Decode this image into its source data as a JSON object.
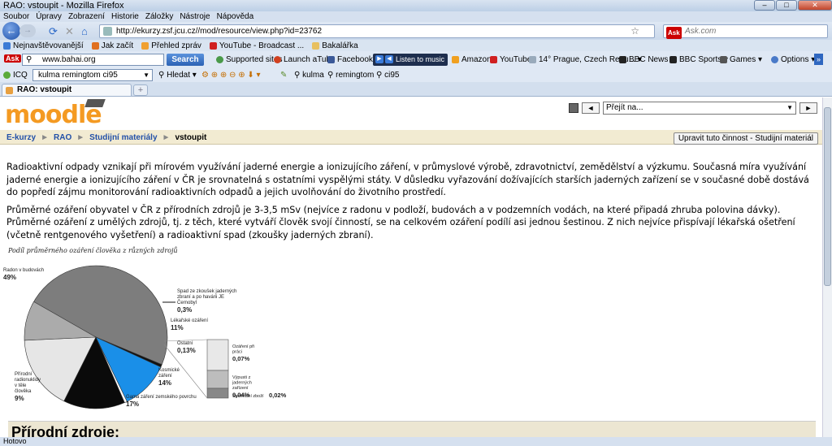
{
  "window": {
    "title": "RAO: vstoupit - Mozilla Firefox"
  },
  "menu": [
    "Soubor",
    "Úpravy",
    "Zobrazení",
    "Historie",
    "Záložky",
    "Nástroje",
    "Nápověda"
  ],
  "address": {
    "url": "http://ekurzy.zsf.jcu.cz//mod/resource/view.php?id=23762",
    "search_placeholder": "Ask.com",
    "search_engine": "Ask"
  },
  "bookmarks": [
    {
      "label": "Nejnavštěvovanější",
      "color": "#3b7bd6"
    },
    {
      "label": "Jak začít",
      "color": "#e07020"
    },
    {
      "label": "Přehled zpráv",
      "color": "#f0a030"
    },
    {
      "label": "YouTube - Broadcast ...",
      "color": "#d02020"
    },
    {
      "label": "Bakalářka",
      "color": "#e8c060"
    }
  ],
  "toolbar1": {
    "search_value": "www.bahai.org",
    "search_button": "Search",
    "items": [
      "Supported sites",
      "Launch aTube",
      "Facebook",
      "Amazon",
      "YouTube",
      "14° Prague, Czech Repu...",
      "BBC News",
      "BBC Sports",
      "Games",
      "Options"
    ],
    "listen": "Listen to music"
  },
  "toolbar2": {
    "icq": "ICQ",
    "search_value": "kulma remingtom ci95",
    "hledat": "Hledat",
    "words": [
      "kulma",
      "remingtom",
      "ci95"
    ]
  },
  "tab": {
    "label": "RAO: vstoupit"
  },
  "moodle": {
    "logo": "moodle",
    "jump_placeholder": "Přejít na...",
    "prev": "◄",
    "next": "►",
    "breadcrumbs": [
      "E-kurzy",
      "RAO",
      "Studijní materiály"
    ],
    "current": "vstoupit",
    "edit_button": "Upravit tuto činnost - Studijní materiál"
  },
  "content": {
    "p1": "Radioaktivní odpady vznikají při mírovém využívání jaderné energie a ionizujícího záření, v průmyslové výrobě, zdravotnictví, zemědělství a výzkumu. Současná míra využívání jaderné energie a ionizujícího záření v ČR je srovnatelná s ostatními vyspělými státy. V důsledku vyřazování dožívajících starších jaderných zařízení se v současné době dostává do popředí zájmu monitorování radioaktivních odpadů a jejich uvolňování do životního prostředí.",
    "p2": "Průměrné ozáření obyvatel v ČR z přírodních zdrojů je 3-3,5 mSv (nejvíce z radonu v podloží, budovách a v podzemních vodách, na které připadá zhruba polovina dávky). Průměrné ozáření z umělých zdrojů, tj. z těch, které vytváří člověk svojí činností, se na celkovém ozáření podílí asi jednou šestinou. Z nich nejvíce přispívají lékařská ošetření (včetně rentgenového vyšetření) a radioaktivní spad (zkoušky jaderných zbraní).",
    "next_heading": "Přírodní zdroje:"
  },
  "chart_data": {
    "type": "pie",
    "title": "Podíl průměrného ozáření člověka z různých zdrojů",
    "slices": [
      {
        "label": "Radon v budovách",
        "value": 49,
        "display": "49%",
        "color": "#7d7d7d"
      },
      {
        "label": "Spad ze zkoušek jaderných zbraní a po havárii JE Černobyl",
        "value": 0.3,
        "display": "0,3%",
        "color": "#111111"
      },
      {
        "label": "Lékařské ozáření",
        "value": 11,
        "display": "11%",
        "color": "#1a8fe8"
      },
      {
        "label": "Ostatní",
        "value": 0.13,
        "display": "0,13%",
        "color": "#ffffff"
      },
      {
        "label": "Kosmické záření",
        "value": 14,
        "display": "14%",
        "color": "#0a0a0a"
      },
      {
        "label": "Gama záření zemského povrchu",
        "value": 17,
        "display": "17%",
        "color": "#e6e6e6"
      },
      {
        "label": "Přírodní radionuklidy v těle člověka",
        "value": 9,
        "display": "9%",
        "color": "#ababab"
      }
    ],
    "breakdown": [
      {
        "label": "Ozáření při práci",
        "display": "0,07%",
        "color": "#e8e8e8"
      },
      {
        "label": "Výpusti z jaderných zařízení",
        "display": "0,04%",
        "color": "#bdbdbd"
      },
      {
        "label": "Spotřební zboží",
        "display": "0,02%",
        "color": "#888888"
      }
    ]
  },
  "status": "Hotovo"
}
